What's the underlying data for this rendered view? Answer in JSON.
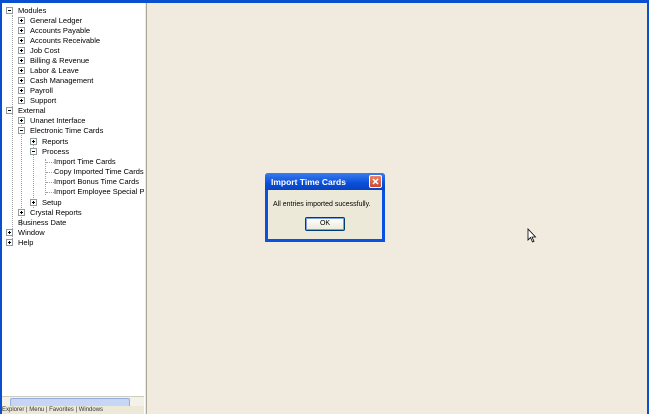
{
  "tree": {
    "items": [
      {
        "label": "Modules",
        "expander": "minus"
      },
      {
        "label": "General Ledger",
        "expander": "plus"
      },
      {
        "label": "Accounts Payable",
        "expander": "plus"
      },
      {
        "label": "Accounts Receivable",
        "expander": "plus"
      },
      {
        "label": "Job Cost",
        "expander": "plus"
      },
      {
        "label": "Billing & Revenue",
        "expander": "plus"
      },
      {
        "label": "Labor & Leave",
        "expander": "plus"
      },
      {
        "label": "Cash Management",
        "expander": "plus"
      },
      {
        "label": "Payroll",
        "expander": "plus"
      },
      {
        "label": "Support",
        "expander": "plus"
      },
      {
        "label": "External",
        "expander": "minus"
      },
      {
        "label": "Unanet Interface",
        "expander": "plus"
      },
      {
        "label": "Electronic Time Cards",
        "expander": "minus"
      },
      {
        "label": "Reports",
        "expander": "plus"
      },
      {
        "label": "Process",
        "expander": "minus"
      },
      {
        "label": "Import Time Cards",
        "expander": "none"
      },
      {
        "label": "Copy Imported Time Cards",
        "expander": "none"
      },
      {
        "label": "Import Bonus Time Cards",
        "expander": "none"
      },
      {
        "label": "Import Employee Special Pay",
        "expander": "none"
      },
      {
        "label": "Setup",
        "expander": "plus"
      },
      {
        "label": "Crystal Reports",
        "expander": "plus"
      },
      {
        "label": "Business Date",
        "expander": "none"
      },
      {
        "label": "Window",
        "expander": "plus"
      },
      {
        "label": "Help",
        "expander": "plus"
      }
    ]
  },
  "bottom_tabs": "Explorer | Menu | Favorites | Windows",
  "dialog": {
    "title": "Import Time Cards",
    "message": "All entries imported sucessfully.",
    "ok_label": "OK"
  },
  "colors": {
    "titlebar": "#0a4fd9",
    "workspace": "#f0eadf",
    "dialog_body": "#ece9d8",
    "close_button": "#d0472c"
  }
}
